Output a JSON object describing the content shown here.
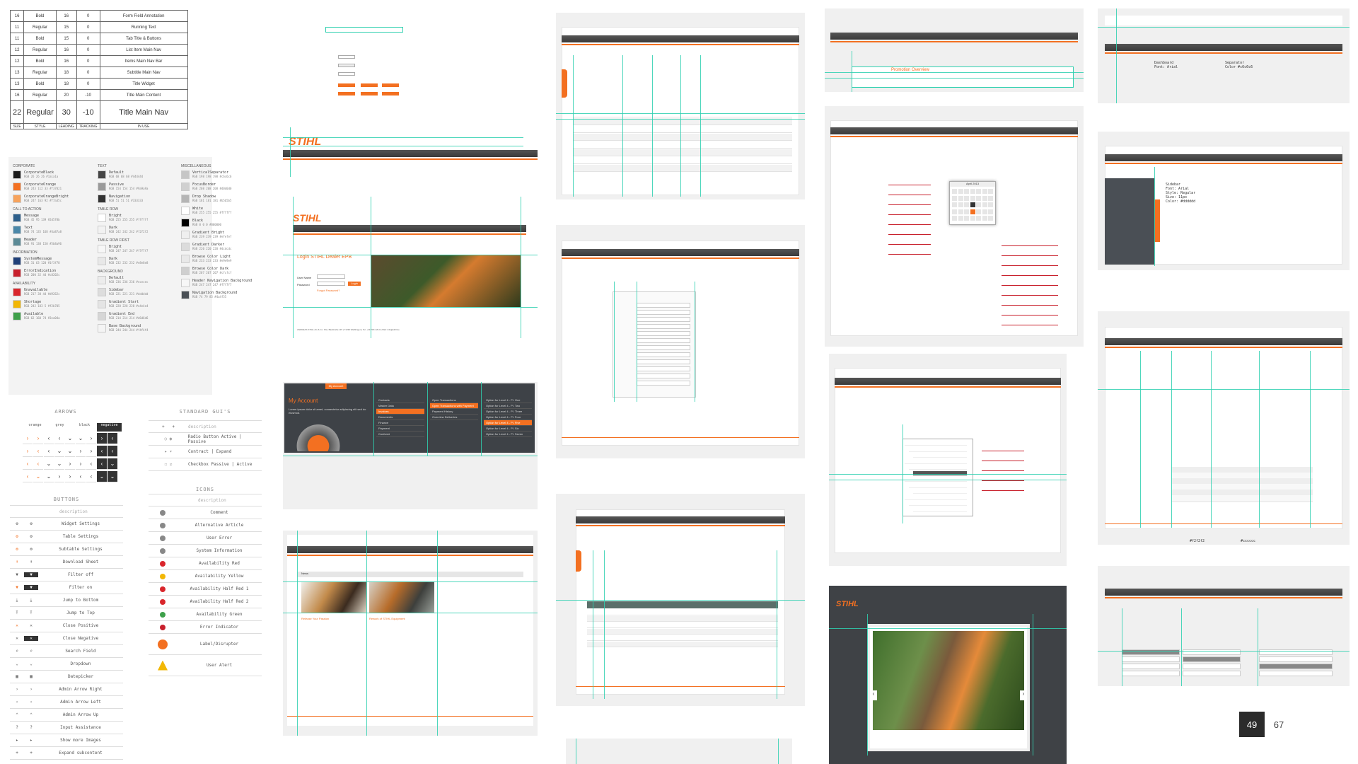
{
  "typography": {
    "rows": [
      {
        "size": "16",
        "style": "Bold",
        "leading": "16",
        "tracking": "0",
        "use": "Form Field Annotation"
      },
      {
        "size": "11",
        "style": "Regular",
        "leading": "15",
        "tracking": "0",
        "use": "Running Text"
      },
      {
        "size": "11",
        "style": "Bold",
        "leading": "15",
        "tracking": "0",
        "use": "Tab Title & Buttons"
      },
      {
        "size": "12",
        "style": "Regular",
        "leading": "16",
        "tracking": "0",
        "use": "List Item Main Nav"
      },
      {
        "size": "12",
        "style": "Bold",
        "leading": "16",
        "tracking": "0",
        "use": "Items Main Nav Bar"
      },
      {
        "size": "13",
        "style": "Regular",
        "leading": "18",
        "tracking": "0",
        "use": "Subtitle Main Nav"
      },
      {
        "size": "13",
        "style": "Bold",
        "leading": "18",
        "tracking": "0",
        "use": "Title Widget"
      },
      {
        "size": "16",
        "style": "Regular",
        "leading": "20",
        "tracking": "-10",
        "use": "Title Main Content"
      },
      {
        "size": "22",
        "style": "Regular",
        "leading": "30",
        "tracking": "-10",
        "use": "Title Main Nav"
      }
    ],
    "header": {
      "size": "SIZE",
      "style": "STYLE",
      "leading": "LEADING",
      "tracking": "TRACKING",
      "use": "IN USE"
    }
  },
  "colors": {
    "col1": [
      {
        "section": "CORPORATE",
        "items": [
          {
            "name": "CorporateBlack",
            "hex": "#1a1a1a",
            "spec": "RGB 26 26 26"
          },
          {
            "name": "CorporateOrange",
            "hex": "#f37021",
            "spec": "RGB 243 112 33"
          },
          {
            "name": "CorporateOrangeBright",
            "hex": "#f7a35c",
            "spec": "RGB 247 163 92"
          }
        ]
      },
      {
        "section": "CALL TO ACTION",
        "items": [
          {
            "name": "Message",
            "hex": "#2d5f8b",
            "spec": "RGB 45 95 139"
          },
          {
            "name": "Text",
            "hex": "#4a87a8",
            "spec": "RGB 74 135 168"
          },
          {
            "name": "Header",
            "hex": "#5b8a96",
            "spec": "RGB 91 138 150"
          }
        ]
      },
      {
        "section": "INFORMATION",
        "items": [
          {
            "name": "SystemMessage",
            "hex": "#1f3f78",
            "spec": "RGB 31 63 120"
          },
          {
            "name": "ErrorIndication",
            "hex": "#c8202c",
            "spec": "RGB 200 32 44"
          }
        ]
      },
      {
        "section": "AVAILABILITY",
        "items": [
          {
            "name": "Unavailable",
            "hex": "#d9262c",
            "spec": "RGB 217 38 44"
          },
          {
            "name": "Shortage",
            "hex": "#f2b705",
            "spec": "RGB 242 183 5"
          },
          {
            "name": "Available",
            "hex": "#3ea04a",
            "spec": "RGB 62 160 74"
          }
        ]
      }
    ],
    "col2": [
      {
        "section": "TEXT",
        "items": [
          {
            "name": "Default",
            "hex": "#444444",
            "spec": "RGB 68 68 68"
          },
          {
            "name": "Passive",
            "hex": "#9a9a9a",
            "spec": "RGB 154 154 154"
          },
          {
            "name": "Navigation",
            "hex": "#333333",
            "spec": "RGB 51 51 51"
          }
        ]
      },
      {
        "section": "TABLE ROW",
        "items": [
          {
            "name": "Bright",
            "hex": "#ffffff",
            "spec": "RGB 255 255 255"
          },
          {
            "name": "Dark",
            "hex": "#f2f2f2",
            "spec": "RGB 242 242 242"
          }
        ]
      },
      {
        "section": "TABLE ROW FIRST",
        "items": [
          {
            "name": "Bright",
            "hex": "#f7f7f7",
            "spec": "RGB 247 247 247"
          },
          {
            "name": "Dark",
            "hex": "#e8e8e8",
            "spec": "RGB 232 232 232"
          }
        ]
      },
      {
        "section": "BACKGROUND",
        "items": [
          {
            "name": "Default",
            "hex": "#ececec",
            "spec": "RGB 236 236 236"
          },
          {
            "name": "Sidebar",
            "hex": "#dddddd",
            "spec": "RGB 221 221 221"
          },
          {
            "name": "Gradient Start",
            "hex": "#e4e4e4",
            "spec": "RGB 228 228 228"
          },
          {
            "name": "Gradient End",
            "hex": "#d6d6d6",
            "spec": "RGB 214 214 214"
          },
          {
            "name": "Base Background",
            "hex": "#f4f4f4",
            "spec": "RGB 244 244 244"
          }
        ]
      }
    ],
    "col3": [
      {
        "section": "MISCELLANEOUS",
        "items": [
          {
            "name": "VerticalSeparator",
            "hex": "#c6c6c6",
            "spec": "RGB 198 198 198"
          },
          {
            "name": "FocusBorder",
            "hex": "#d0d0d0",
            "spec": "RGB 208 208 208"
          },
          {
            "name": "Drop Shadow",
            "hex": "#b5b5b5",
            "spec": "RGB 181 181 181"
          },
          {
            "name": "White",
            "hex": "#ffffff",
            "spec": "RGB 255 255 255"
          },
          {
            "name": "Black",
            "hex": "#000000",
            "spec": "RGB 0 0 0"
          },
          {
            "name": "Gradient Bright",
            "hex": "#efefef",
            "spec": "RGB 239 239 239"
          },
          {
            "name": "Gradient Darker",
            "hex": "#dcdcdc",
            "spec": "RGB 220 220 220"
          },
          {
            "name": "Browse Color Light",
            "hex": "#e9e9e9",
            "spec": "RGB 233 233 233"
          },
          {
            "name": "Browse Color Dark",
            "hex": "#cfcfcf",
            "spec": "RGB 207 207 207"
          },
          {
            "name": "Header Navigation Background",
            "hex": "#f7f7f7",
            "spec": "RGB 247 247 247"
          },
          {
            "name": "Navigation Background",
            "hex": "#4a4f55",
            "spec": "RGB 74 79 85"
          }
        ]
      }
    ]
  },
  "arrows": {
    "title": "ARROWS",
    "headers": [
      "orange",
      "grey",
      "black",
      "negative"
    ]
  },
  "standard_guis": {
    "title": "STANDARD GUI'S",
    "header": "description",
    "rows": [
      "Radio Button Active | Passive",
      "Contract | Expand",
      "Checkbox Passive | Active"
    ]
  },
  "buttons": {
    "title": "BUTTONS",
    "header": "description",
    "rows": [
      "Widget Settings",
      "Table Settings",
      "Subtable Settings",
      "Download Sheet",
      "Filter off",
      "Filter on",
      "Jump to Bottom",
      "Jump to Top",
      "Close Positive",
      "Close Negative",
      "Search Field",
      "Dropdown",
      "Datepicker",
      "Admin Arrow Right",
      "Admin Arrow Left",
      "Admin Arrow Up",
      "Input Assistance",
      "Show more Images",
      "Expand subcontent"
    ]
  },
  "icons": {
    "title": "ICONS",
    "header": "description",
    "rows": [
      "Comment",
      "Alternative Article",
      "User Error",
      "System Information",
      "Availability Red",
      "Availability Yellow",
      "Availability Half Red 1",
      "Availability Half Red 2",
      "Availability Green",
      "Error Indicator",
      "Label/Disrupter",
      "User Alert"
    ]
  },
  "screens": {
    "brand": "STIHL",
    "login": {
      "title": "Login STIHL Dealer EPB",
      "user_label": "User Name",
      "pass_label": "Password",
      "button": "Login",
      "forgot": "Forgot Password?",
      "footer": "ANDREAS STIHL AG & Co. KG  |  Badstraße 115  |  71336 Waiblingen  |  Tel. +49 7151 26-0  |  Mail: info@stihl.de"
    },
    "myaccount": {
      "tab": "My Account",
      "title": "My Account",
      "intro": "Lorem ipsum dolor sit amet, consectetur adipiscing elit sed do eiusmod.",
      "menu": [
        "Contacts",
        "Master Data",
        "Invoices",
        "Documents",
        "Finance",
        "Payment",
        "Conformi"
      ],
      "menu2": [
        "Open Transactions",
        "Open Transactions with Payment",
        "Payment History",
        "Overview Deliveries"
      ],
      "menu3": [
        "Option for Level 4 - Pl. One",
        "Option for Level 4 - Pl. Two",
        "Option for Level 4 - Pl. Three",
        "Option for Level 4 - Pl. Four",
        "Option for Level 4 - Pl. Five",
        "Option for Level 4 - Pl. Six",
        "Option for Level 4 - Pl. Seven"
      ]
    },
    "promotion_overview": "Promotion Overview",
    "datepicker_month": "April 2013",
    "gallery": {
      "news": "News",
      "caption1": "Release Your Passion",
      "caption2": "Rework of STIHL Equipment"
    },
    "totals": {
      "left": "#f2f2f2",
      "right": "#cccccc"
    }
  },
  "page_numbers": {
    "current": "49",
    "next": "67"
  }
}
